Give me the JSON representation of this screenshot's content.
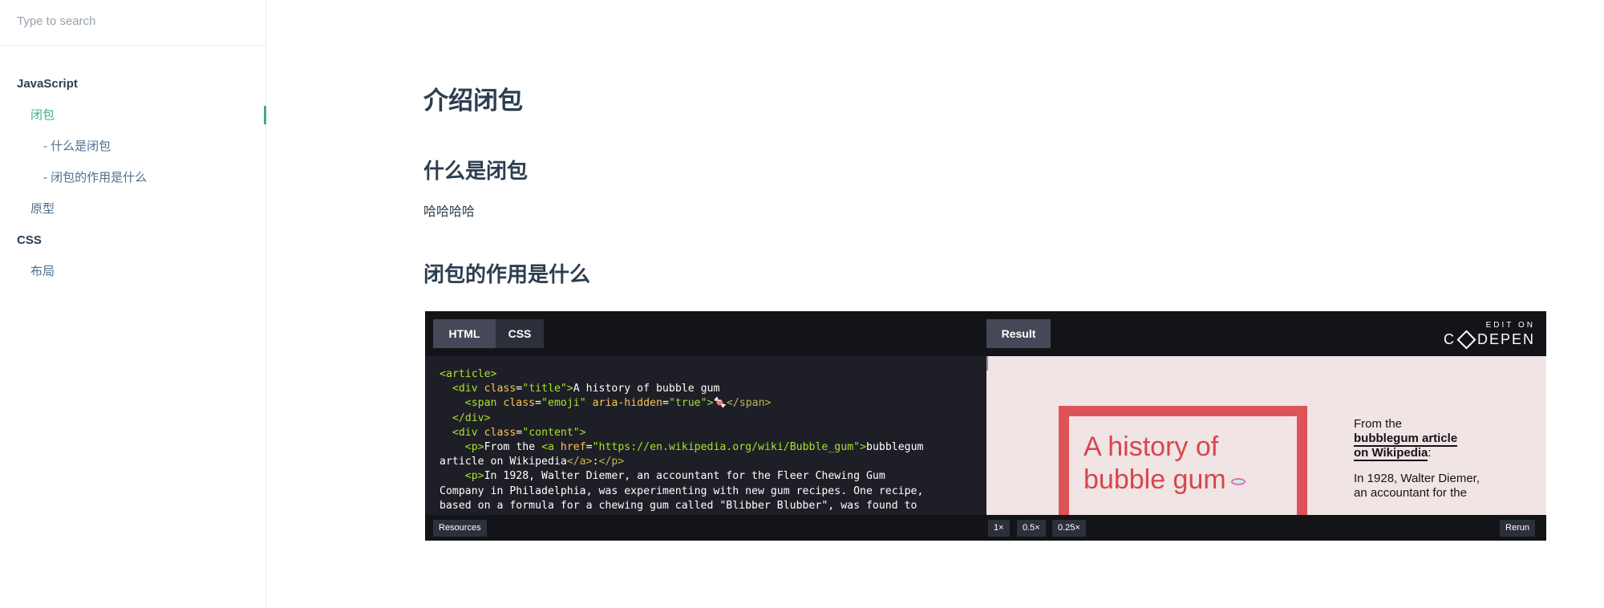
{
  "search": {
    "placeholder": "Type to search"
  },
  "sidebar": {
    "groups": [
      {
        "label": "JavaScript"
      },
      {
        "label": "CSS"
      }
    ],
    "items": [
      {
        "label": "闭包"
      },
      {
        "label": "- 什么是闭包"
      },
      {
        "label": "- 闭包的作用是什么"
      },
      {
        "label": "原型"
      },
      {
        "label": "布局"
      }
    ],
    "active_color": "#3eaf7c"
  },
  "content": {
    "h1": "介绍闭包",
    "h2_1": "什么是闭包",
    "p1": "哈哈哈哈",
    "h2_2": "闭包的作用是什么"
  },
  "codepen": {
    "tabs": {
      "html": "HTML",
      "css": "CSS",
      "result": "Result"
    },
    "edit_on": "EDIT ON",
    "brand_c": "C",
    "brand_rest": "DEPEN",
    "code": {
      "l1_tag": "<article>",
      "l2_open": "<div ",
      "l2_attr": "class",
      "l2_str": "\"title\"",
      "l2_text": "A history of bubble gum",
      "l3_open": "<span ",
      "l3_attr1": "class",
      "l3_str1": "\"emoji\"",
      "l3_attr2": "aria-hidden",
      "l3_str2": "\"true\"",
      "l3_emoji": "🍬",
      "l3_close": "</span>",
      "l4_close": "</div>",
      "l5_open": "<div ",
      "l5_attr": "class",
      "l5_str": "\"content\"",
      "l6_p": "<p>",
      "l6_text1": "From the ",
      "l6_a": "<a ",
      "l6_attr": "href",
      "l6_str": "\"https://en.wikipedia.org/wiki/Bubble_gum\"",
      "l6_text2": "bubblegum",
      "l7_text": "article on Wikipedia",
      "l7_close": "</a>",
      "l7_colon": ":",
      "l7_pclose": "</p>",
      "l8_p": "<p>",
      "l8_text": "In 1928, Walter Diemer, an accountant for the Fleer Chewing Gum",
      "l9_text": "Company in Philadelphia, was experimenting with new gum recipes. One recipe,",
      "l10_text": "based on a formula for a chewing gum called \"Blibber Blubber\", was found to"
    },
    "result": {
      "card_title_1": "A history of",
      "card_title_2": "bubble gum",
      "side_from": "From the",
      "side_link_1": "bubblegum article",
      "side_link_2": "on Wikipedia",
      "side_colon": ":",
      "side_p2": "In 1928, Walter Diemer, an accountant for the"
    },
    "footer": {
      "resources": "Resources",
      "zoom": [
        "1×",
        "0.5×",
        "0.25×"
      ],
      "rerun": "Rerun"
    }
  }
}
